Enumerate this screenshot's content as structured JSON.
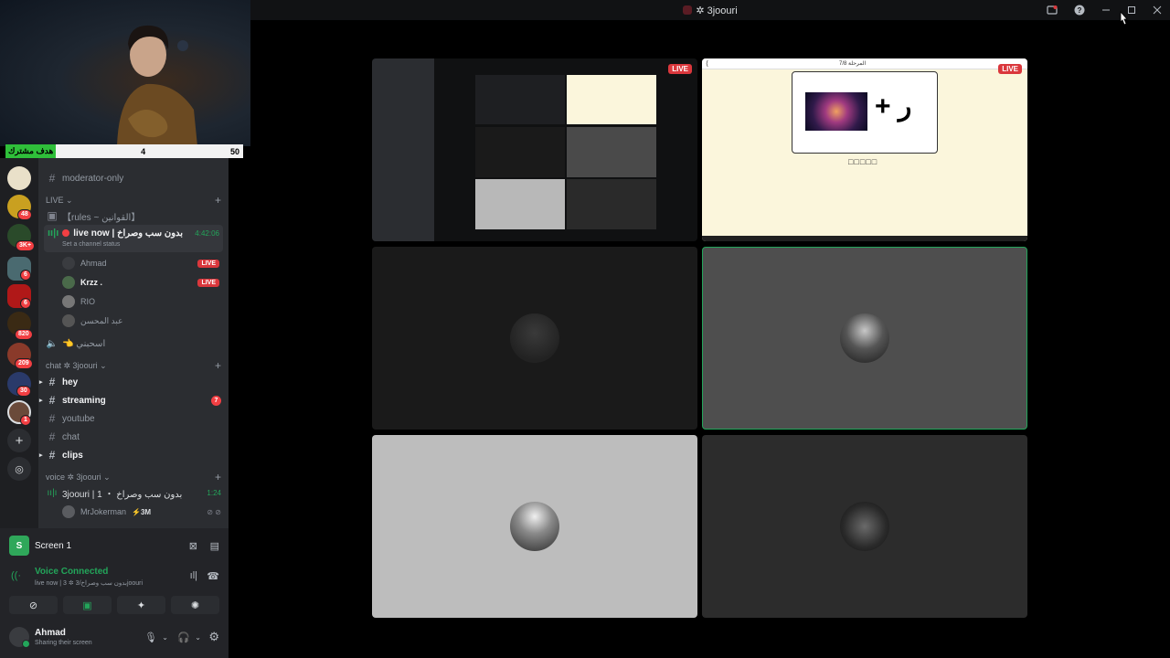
{
  "window": {
    "title": "✲ 3joouri"
  },
  "goal_bar": {
    "label": "هدف مشترك",
    "current": "4",
    "max": "50"
  },
  "rail": {
    "badges": [
      "48",
      "3K+",
      "6",
      "6",
      "820",
      "209",
      "30",
      "1"
    ]
  },
  "sidebar": {
    "moderator_channel": "moderator-only",
    "live_category": "LIVE",
    "rules_channel": "【rules ~ القوانين】",
    "live_voice": {
      "name": "live now | بدون سب وصراخ",
      "timer": "4:42:06",
      "status": "Set a channel status"
    },
    "voice_users": [
      {
        "name": "Ahmad",
        "live": "LIVE"
      },
      {
        "name": "Krzz .",
        "live": "LIVE"
      },
      {
        "name": "RIO",
        "live": ""
      },
      {
        "name": "عبد المحسن",
        "live": ""
      }
    ],
    "stage_channel": "👈 اسحبني",
    "chat_category": "chat ✲ 3joouri",
    "text_channels": [
      {
        "name": "hey",
        "mention": ""
      },
      {
        "name": "streaming",
        "mention": "7"
      },
      {
        "name": "youtube",
        "mention": ""
      },
      {
        "name": "chat",
        "mention": ""
      },
      {
        "name": "clips",
        "mention": ""
      }
    ],
    "voice_category": "voice ✲ 3joouri",
    "voice_channel": {
      "name": "3joouri | 1 ・ بدون سب وصراخ",
      "timer": "1:24",
      "member": "MrJokerman",
      "member_boost": "⚡3M"
    }
  },
  "panel": {
    "screen_icon_letter": "S",
    "screen_title": "Screen 1",
    "voice_connected": "Voice Connected",
    "voice_sub": "live now | 3 ✲ بدون سب وصراخ/3joouri",
    "user_name": "Ahmad",
    "user_status": "Sharing their screen"
  },
  "stage": {
    "live_label": "LIVE",
    "quiz_header": "المرحلة 7/8",
    "quiz_plus": "+ ر",
    "quiz_answer": "□□□□□"
  },
  "colors": {
    "green": "#23a55a",
    "red": "#da373c",
    "bg_dark": "#1e1f22"
  }
}
